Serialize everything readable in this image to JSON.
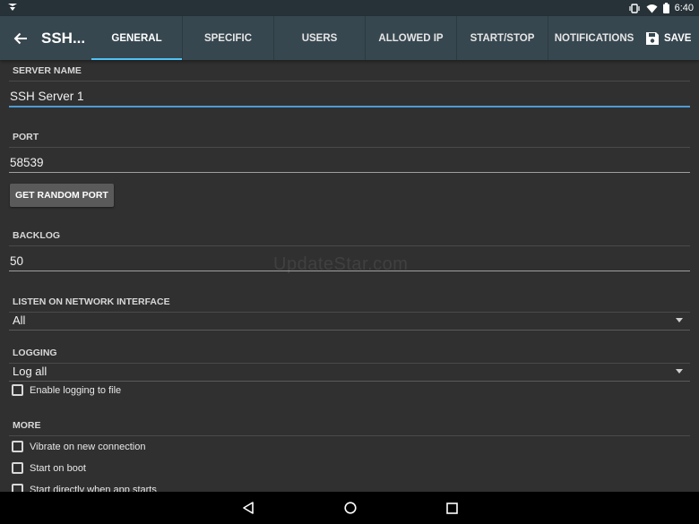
{
  "status_bar": {
    "time": "6:40"
  },
  "toolbar": {
    "title": "SSH...",
    "tabs": [
      {
        "label": "GENERAL",
        "active": true
      },
      {
        "label": "SPECIFIC",
        "active": false
      },
      {
        "label": "USERS",
        "active": false
      },
      {
        "label": "ALLOWED IP",
        "active": false
      },
      {
        "label": "START/STOP",
        "active": false
      },
      {
        "label": "NOTIFICATIONS",
        "active": false
      }
    ],
    "save_label": "SAVE"
  },
  "form": {
    "server_name": {
      "header": "SERVER NAME",
      "value": "SSH Server 1"
    },
    "port": {
      "header": "PORT",
      "value": "58539",
      "random_button": "GET RANDOM PORT"
    },
    "backlog": {
      "header": "BACKLOG",
      "value": "50"
    },
    "listen": {
      "header": "LISTEN ON NETWORK INTERFACE",
      "selected": "All"
    },
    "logging": {
      "header": "LOGGING",
      "selected": "Log all",
      "file_checkbox": "Enable logging to file"
    },
    "more": {
      "header": "MORE",
      "vibrate": "Vibrate on new connection",
      "start_on_boot": "Start on boot",
      "start_directly": "Start directly when app starts"
    }
  },
  "watermark": "UpdateStar.com",
  "colors": {
    "toolbar": "#37474f",
    "status_bar": "#263238",
    "accent": "#4fc3f7",
    "background": "#303030"
  }
}
